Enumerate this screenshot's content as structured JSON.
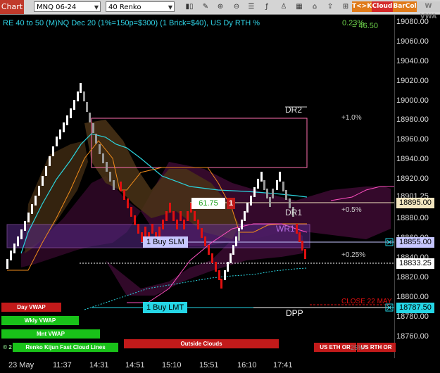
{
  "toolbar": {
    "title": "Chart",
    "instrument": "MNQ 06-24",
    "bar_type": "40 Renko",
    "icons": [
      "bar-style-icon",
      "draw-icon",
      "zoom-in-icon",
      "zoom-out-icon",
      "properties-icon",
      "indicators-icon",
      "strategies-icon",
      "calendar-icon",
      "attach-icon",
      "share-icon",
      "grid-icon"
    ],
    "tags": [
      {
        "label": "T<>K",
        "bg": "#e07b1a",
        "fg": "#fff"
      },
      {
        "label": "Cloud",
        "bg": "#d42a2a",
        "fg": "#fff"
      },
      {
        "label": "BarCol",
        "bg": "#e07b1a",
        "fg": "#fff"
      },
      {
        "label": "W VWA",
        "bg": "#ccc",
        "fg": "#777"
      }
    ]
  },
  "header": {
    "description": "RE 40 to 50 (M)NQ Dec 20 (1%=150p=$300) (1 Brick=$40), US Dy RTH %",
    "readout_a": "0.23%",
    "readout_b": "= 46.50"
  },
  "y_axis_labels": [
    "19080.00",
    "19060.00",
    "19040.00",
    "19020.00",
    "19000.00",
    "18980.00",
    "18960.00",
    "18940.00",
    "18920.00",
    "18901.25",
    "18880.00",
    "18860.00",
    "18840.00",
    "18820.00",
    "18800.00",
    "18780.00",
    "18760.00"
  ],
  "x_axis_labels": [
    "23 May",
    "11:37",
    "14:31",
    "14:51",
    "15:10",
    "15:51",
    "16:10",
    "17:41"
  ],
  "price_markers": [
    {
      "label": "18895.00",
      "bg": "#f3e6c0"
    },
    {
      "label": "18855.00",
      "bg": "#c7c7ff"
    },
    {
      "label": "18833.25",
      "bg": "#ffffff"
    },
    {
      "label": "18787.50",
      "bg": "#25d6e6"
    }
  ],
  "levels": {
    "dr2": "DR2",
    "dr1": "DR1",
    "wr1": "WR1",
    "dpp": "DPP",
    "pct_1": "+1.0%",
    "pct_05": "+0.5%",
    "pct_025": "+0.25%",
    "close_label": "CLOSE 22 MAY"
  },
  "orders": {
    "buy_slm": "1 Buy SLM",
    "buy_lmt": "1 Buy LMT",
    "position_price": "61.75",
    "position_qty": "1"
  },
  "bottom_labels": {
    "day_vwap": "Day VWAP",
    "wkly_vwap": "Wkly VWAP",
    "mnt_vwap": "Mnt VWAP",
    "ichimoku": "Renko Kijun Fast Cloud Lines",
    "outside_clouds": "Outside Clouds",
    "us_eth": "US ETH OR",
    "us_rth": "US RTH OR",
    "copyright": "© 2",
    "pct_bottom": "25%"
  }
}
